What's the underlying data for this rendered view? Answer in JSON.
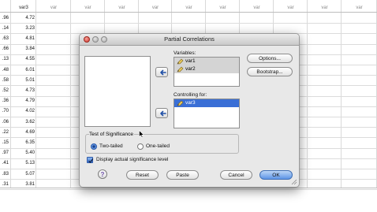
{
  "spreadsheet": {
    "columns": [
      "",
      "var3",
      "var",
      "var",
      "var",
      "var",
      "var",
      "var",
      "var",
      "var",
      "var",
      "var"
    ],
    "col_a_values": [
      ".96",
      ".14",
      ".63",
      ".66",
      ".13",
      ".48",
      ".58",
      ".52",
      ".36",
      ".70",
      ".06",
      ".22",
      ".15",
      ".97",
      ".41",
      ".83",
      ".31"
    ],
    "var3_values": [
      "4.72",
      "3.23",
      "4.81",
      "3.84",
      "4.55",
      "6.01",
      "5.01",
      "4.73",
      "4.79",
      "4.02",
      "3.62",
      "4.69",
      "6.35",
      "5.40",
      "5.13",
      "5.07",
      "3.81"
    ]
  },
  "dialog": {
    "title": "Partial Correlations",
    "variables_label": "Variables:",
    "variables": [
      "var1",
      "var2"
    ],
    "controlling_label": "Controlling for:",
    "controlling": [
      "var3"
    ],
    "options_button": "Options...",
    "bootstrap_button": "Bootstrap...",
    "test_group_title": "Test of Significance",
    "two_tailed": "Two-tailed",
    "one_tailed": "One-tailed",
    "display_sig_label": "Display actual significance level",
    "help_button": "?",
    "reset_button": "Reset",
    "paste_button": "Paste",
    "cancel_button": "Cancel",
    "ok_button": "OK",
    "selected_test": "two-tailed",
    "display_sig_checked": true
  },
  "colors": {
    "selection_blue": "#3a6fd6",
    "default_button": "#5d94e6",
    "close_red": "#d0362b"
  }
}
